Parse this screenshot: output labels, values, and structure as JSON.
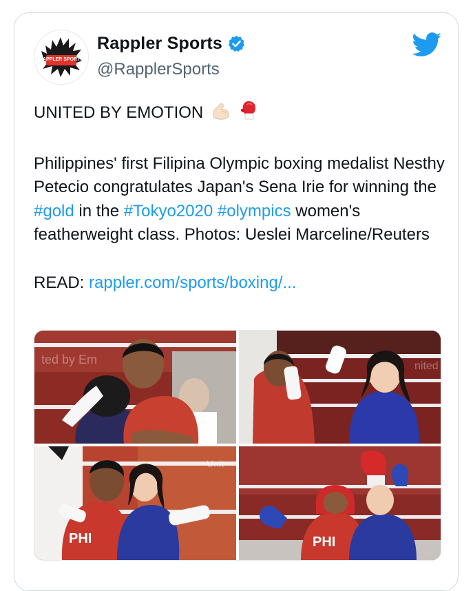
{
  "tweet": {
    "author": {
      "display_name": "Rappler Sports",
      "handle": "@RapplerSports",
      "verified": true,
      "avatar_text": "RAPPLER SPORTS"
    },
    "headline": "UNITED BY EMOTION",
    "headline_emojis": [
      "flexed-biceps",
      "boxing-glove"
    ],
    "body": {
      "text_1": "Philippines' first Filipina Olympic boxing medalist Nesthy Petecio congratulates Japan's Sena Irie for winning the ",
      "hashtag_gold": "#gold",
      "text_2": " in the ",
      "hashtag_tokyo": "#Tokyo2020",
      "text_3": " ",
      "hashtag_olympics": "#olympics",
      "text_4": " women's featherweight class. Photos: Ueslei Marceline/Reuters"
    },
    "read_label": "READ: ",
    "read_link": "rappler.com/sports/boxing/...",
    "photos": [
      {
        "description": "Petecio embracing Irie in the ring"
      },
      {
        "description": "Petecio and Irie high-five in the ring"
      },
      {
        "description": "Petecio and Irie hugging"
      },
      {
        "description": "Petecio and Irie with raised gloves"
      }
    ],
    "photo_texts": {
      "p3_jersey": "PHI",
      "p4_jersey": "PHI",
      "p1_backdrop": "ted by Em",
      "p2_backdrop": "nited",
      "p3_backdrop": "Unit"
    }
  },
  "colors": {
    "link": "#1d9bf0",
    "text": "#0f1419",
    "secondary": "#536471",
    "verified": "#1d9bf0",
    "twitter_blue": "#1d9bf0"
  }
}
